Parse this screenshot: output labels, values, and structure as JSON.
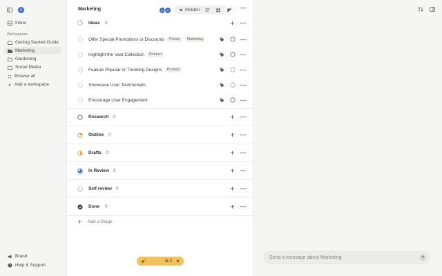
{
  "sidebar": {
    "avatar_initial": "A",
    "inbox": "Inbox",
    "section_label": "Workspaces",
    "workspaces": [
      {
        "label": "Getting Started Guide"
      },
      {
        "label": "Marketing"
      },
      {
        "label": "Gardening"
      },
      {
        "label": "Social Media"
      }
    ],
    "browse_all": "Browse all",
    "add_workspace": "Add a workspace",
    "brand": "Brand",
    "help": "Help & Support"
  },
  "header": {
    "title": "Marketing",
    "avatars": [
      "A",
      "A"
    ],
    "share_label": "Mobbin"
  },
  "ideas": {
    "name": "Ideas",
    "count": "5",
    "tasks": [
      {
        "title": "Offer Special Promotions or Discounts",
        "tags": [
          "Promo",
          "Marketing"
        ]
      },
      {
        "title": "Highlight the Vast Collection",
        "tags": [
          "Product"
        ]
      },
      {
        "title": "Feature Popular or Trending Designs",
        "tags": [
          "Product"
        ]
      },
      {
        "title": "Showcase User Testimonials",
        "tags": []
      },
      {
        "title": "Encourage User Engagement",
        "tags": []
      }
    ]
  },
  "stages": [
    {
      "name": "Research",
      "count": "0",
      "color": "#555555"
    },
    {
      "name": "Outline",
      "count": "0",
      "color": "#e8932b"
    },
    {
      "name": "Drafts",
      "count": "0",
      "color": "#e8a92b"
    },
    {
      "name": "In Review",
      "count": "0",
      "color": "#3f6ad8"
    },
    {
      "name": "Self review",
      "count": "0",
      "color": "#666666"
    },
    {
      "name": "Done",
      "count": "0",
      "color": "#3d3d3d"
    }
  ],
  "add_stage": "Add a Stage",
  "command_bar": {
    "shortcut": "⌘ K"
  },
  "chat": {
    "placeholder": "Send a message about Marketing"
  },
  "colors": {
    "accent": "#3f6ad8",
    "command_bar": "#f3c25a"
  }
}
